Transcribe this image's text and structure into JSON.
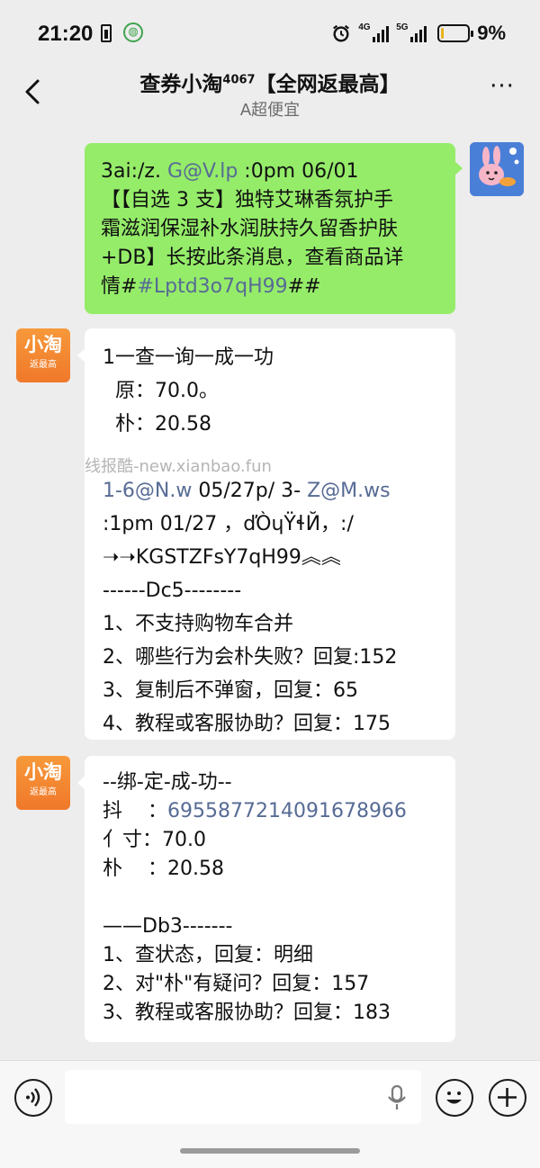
{
  "status_bar": {
    "time": "21:20",
    "network_1": "4G",
    "network_2": "5G",
    "battery_percent": "9%",
    "battery_level": 0.09
  },
  "header": {
    "title_main": "查券小淘",
    "title_sup": "4067",
    "title_tail": "【全网返最高】",
    "subtitle": "A超便宜"
  },
  "messages": {
    "msg1": {
      "lines": [
        {
          "a": "3ai:/z. ",
          "link": "G@V.lp",
          "b": " :0pm 06/01"
        },
        {
          "a": "【【自选 3 支】独特艾琳香氛护手"
        },
        {
          "a": "霜滋润保湿补水润肤持久留香护肤"
        },
        {
          "a": "+DB】长按此条消息，查看商品详"
        },
        {
          "a": "情#",
          "link": "#Lptd3o7qH99",
          "b": "##"
        }
      ]
    },
    "shop_avatar": {
      "big": "小淘",
      "small": "返最高"
    },
    "msg2": {
      "line1": "1一查一询一成一功",
      "line2": "  原：70.0。",
      "line3": "  朴：20.58",
      "watermark": "线报酷-new.xianbao.fun",
      "line5_link1": "1-6@N.w",
      "line5_mid": " 05/27p/ 3- ",
      "line5_link2": "Z@M.ws",
      "line6": ":1pm 01/27 ，ďÒɥŸɬЙ，:/",
      "line7": "➝➝KGSTZFsY7qH99︽︽",
      "line8": "------Dc5--------",
      "line9": "1、不支持购物车合并",
      "line10": "2、哪些行为会朴失败？回复:152",
      "line11": "3、复制后不弹窗，回复：65",
      "line12": "4、教程或客服协助？回复：175"
    },
    "msg3": {
      "line1": "--绑-定-成-功--",
      "line2_label": "抖    ：",
      "line2_link": "6955877214091678966",
      "line3": "亻寸：70.0",
      "line4": "朴    ：20.58",
      "line6": "——Db3-------",
      "line7": "1、查状态，回复：明细",
      "line8": "2、对\"朴\"有疑问？回复：157",
      "line9": "3、教程或客服协助？回复：183"
    }
  },
  "input": {
    "value": "",
    "placeholder": ""
  },
  "colors": {
    "bubble_sent": "#95ec69",
    "bubble_received": "#ffffff",
    "link": "#576b95",
    "background": "#ededed"
  }
}
